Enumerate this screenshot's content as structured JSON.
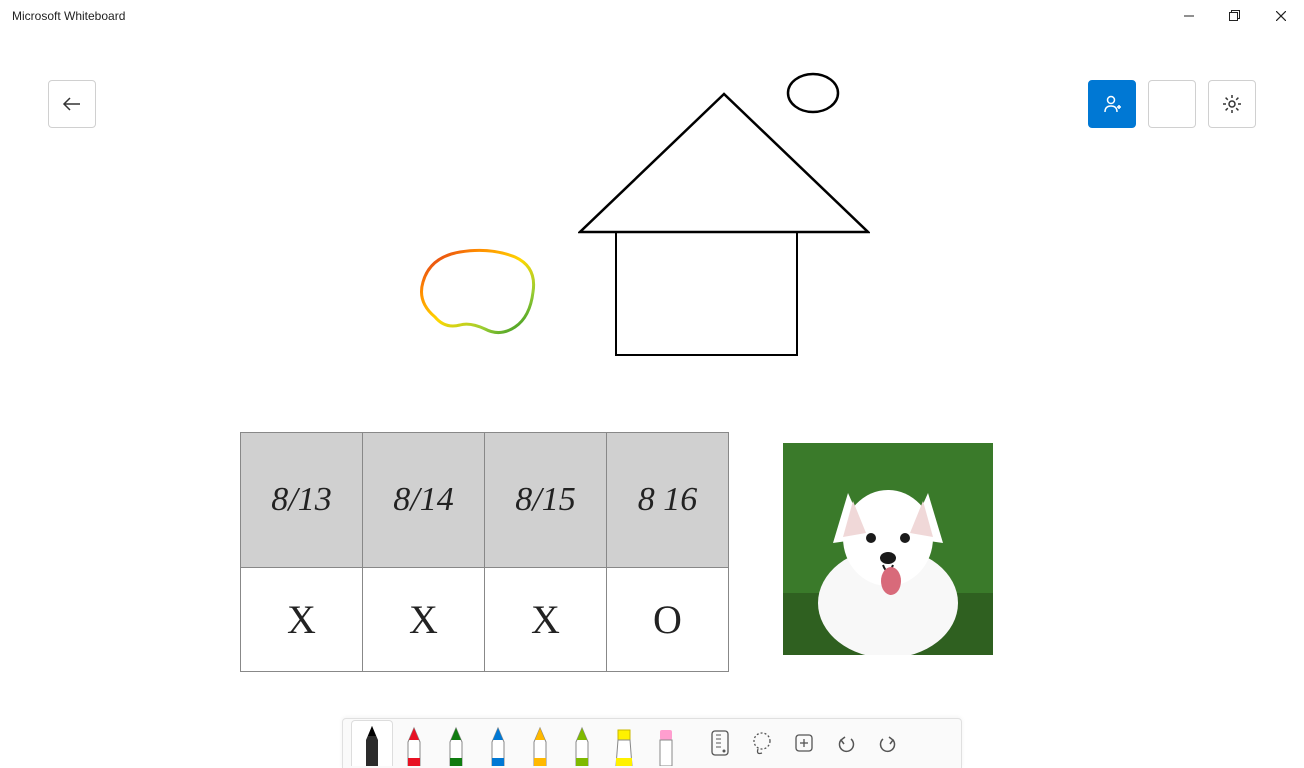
{
  "window": {
    "title": "Microsoft Whiteboard"
  },
  "icons": {
    "back": "back-arrow",
    "invite": "person-add",
    "signin": "signin",
    "settings": "gear"
  },
  "canvas": {
    "table": {
      "headers": [
        "8/13",
        "8/14",
        "8/15",
        "8 16"
      ],
      "row": [
        "X",
        "X",
        "X",
        "O"
      ]
    },
    "image": {
      "alt": "white dog on grass"
    }
  },
  "toolbar": {
    "tools": [
      {
        "name": "pen-black",
        "color": "#000000",
        "selected": true
      },
      {
        "name": "pen-red",
        "color": "#e81123"
      },
      {
        "name": "pen-green",
        "color": "#107c10"
      },
      {
        "name": "pen-blue",
        "color": "#0078d4"
      },
      {
        "name": "pen-yellow",
        "color": "#ffb900"
      },
      {
        "name": "pen-lightgreen",
        "color": "#7fba00"
      },
      {
        "name": "highlighter",
        "color": "#fff100"
      },
      {
        "name": "eraser",
        "color": "#ff69b4"
      }
    ],
    "actions": [
      "ruler",
      "lasso",
      "add",
      "undo",
      "redo"
    ]
  },
  "accent_color": "#0078d4"
}
